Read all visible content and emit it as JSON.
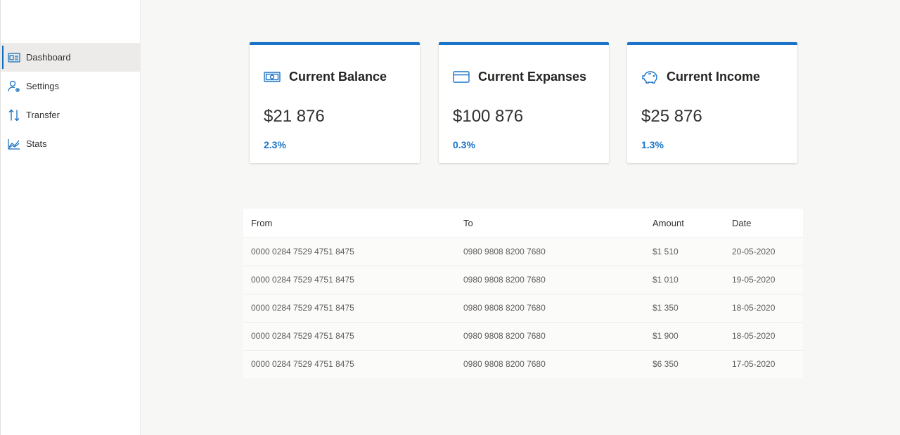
{
  "nav": {
    "items": [
      {
        "label": "Dashboard",
        "icon": "dashboard-icon",
        "active": true
      },
      {
        "label": "Settings",
        "icon": "user-settings-icon",
        "active": false
      },
      {
        "label": "Transfer",
        "icon": "transfer-arrows-icon",
        "active": false
      },
      {
        "label": "Stats",
        "icon": "chart-line-icon",
        "active": false
      }
    ]
  },
  "cards": [
    {
      "title": "Current Balance",
      "icon": "money-icon",
      "value": "$21 876",
      "change": "2.3%"
    },
    {
      "title": "Current Expanses",
      "icon": "credit-card-icon",
      "value": "$100 876",
      "change": "0.3%"
    },
    {
      "title": "Current Income",
      "icon": "piggy-bank-icon",
      "value": "$25 876",
      "change": "1.3%"
    }
  ],
  "table": {
    "headers": {
      "from": "From",
      "to": "To",
      "amount": "Amount",
      "date": "Date"
    },
    "rows": [
      {
        "from": "0000 0284 7529 4751 8475",
        "to": "0980 9808 8200 7680",
        "amount": "$1 510",
        "date": "20-05-2020"
      },
      {
        "from": "0000 0284 7529 4751 8475",
        "to": "0980 9808 8200 7680",
        "amount": "$1 010",
        "date": "19-05-2020"
      },
      {
        "from": "0000 0284 7529 4751 8475",
        "to": "0980 9808 8200 7680",
        "amount": "$1 350",
        "date": "18-05-2020"
      },
      {
        "from": "0000 0284 7529 4751 8475",
        "to": "0980 9808 8200 7680",
        "amount": "$1 900",
        "date": "18-05-2020"
      },
      {
        "from": "0000 0284 7529 4751 8475",
        "to": "0980 9808 8200 7680",
        "amount": "$6 350",
        "date": "17-05-2020"
      }
    ]
  },
  "colors": {
    "accent": "#1a73c8",
    "background": "#f7f7f5",
    "active_nav": "#edebe9"
  }
}
